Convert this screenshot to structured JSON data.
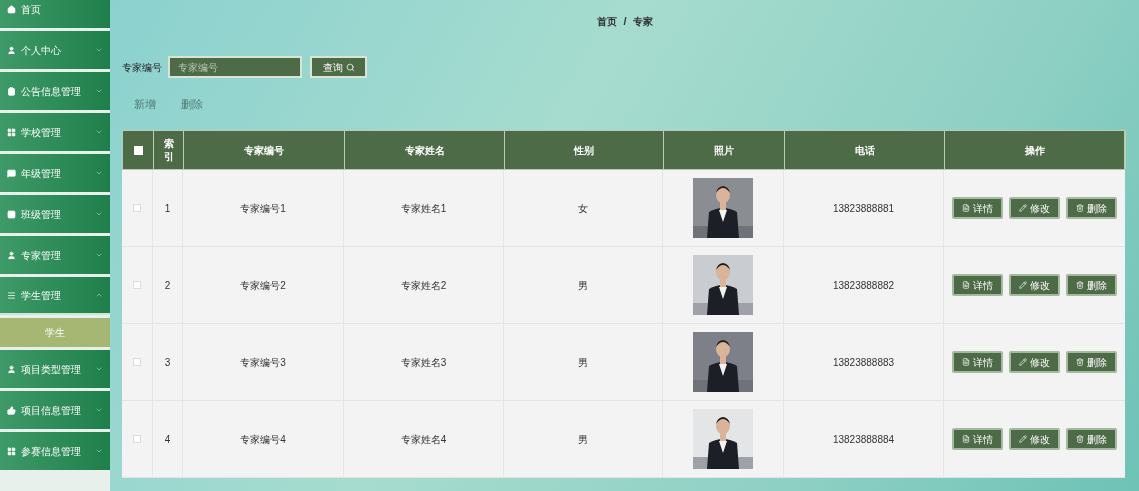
{
  "sidebar": {
    "items": [
      {
        "label": "首页",
        "expanded": false
      },
      {
        "label": "个人中心",
        "expanded": false
      },
      {
        "label": "公告信息管理",
        "expanded": false
      },
      {
        "label": "学校管理",
        "expanded": false
      },
      {
        "label": "年级管理",
        "expanded": false
      },
      {
        "label": "班级管理",
        "expanded": false
      },
      {
        "label": "专家管理",
        "expanded": false
      },
      {
        "label": "学生管理",
        "expanded": true,
        "children": [
          {
            "label": "学生",
            "selected": true
          }
        ]
      },
      {
        "label": "项目类型管理",
        "expanded": false
      },
      {
        "label": "项目信息管理",
        "expanded": false
      },
      {
        "label": "参赛信息管理",
        "expanded": false
      }
    ]
  },
  "breadcrumb": {
    "items": [
      "首页",
      "专家"
    ],
    "separator": "/"
  },
  "search": {
    "label": "专家编号",
    "placeholder": "专家编号",
    "button": "查询"
  },
  "actions": [
    {
      "label": "新增",
      "disabled": true
    },
    {
      "label": "删除",
      "disabled": true
    }
  ],
  "table": {
    "columns": [
      "索引",
      "专家编号",
      "专家姓名",
      "性别",
      "照片",
      "电话",
      "操作"
    ],
    "header_checked": false,
    "rows": [
      {
        "index": "1",
        "code": "专家编号1",
        "name": "专家姓名1",
        "gender": "女",
        "phone": "13823888881",
        "checked": false,
        "buttons": [
          {
            "kind": "detail",
            "label": "详情"
          },
          {
            "kind": "edit",
            "label": "修改"
          },
          {
            "kind": "delete",
            "label": "删除"
          }
        ]
      },
      {
        "index": "2",
        "code": "专家编号2",
        "name": "专家姓名2",
        "gender": "男",
        "phone": "13823888882",
        "checked": false,
        "buttons": [
          {
            "kind": "detail",
            "label": "详情"
          },
          {
            "kind": "edit",
            "label": "修改"
          },
          {
            "kind": "delete",
            "label": "删除"
          }
        ]
      },
      {
        "index": "3",
        "code": "专家编号3",
        "name": "专家姓名3",
        "gender": "男",
        "phone": "13823888883",
        "checked": false,
        "buttons": [
          {
            "kind": "detail",
            "label": "详情"
          },
          {
            "kind": "edit",
            "label": "修改"
          },
          {
            "kind": "delete",
            "label": "删除"
          }
        ]
      },
      {
        "index": "4",
        "code": "专家编号4",
        "name": "专家姓名4",
        "gender": "男",
        "phone": "13823888884",
        "checked": false,
        "buttons": [
          {
            "kind": "detail",
            "label": "详情"
          },
          {
            "kind": "edit",
            "label": "修改"
          },
          {
            "kind": "delete",
            "label": "删除"
          }
        ]
      }
    ]
  }
}
